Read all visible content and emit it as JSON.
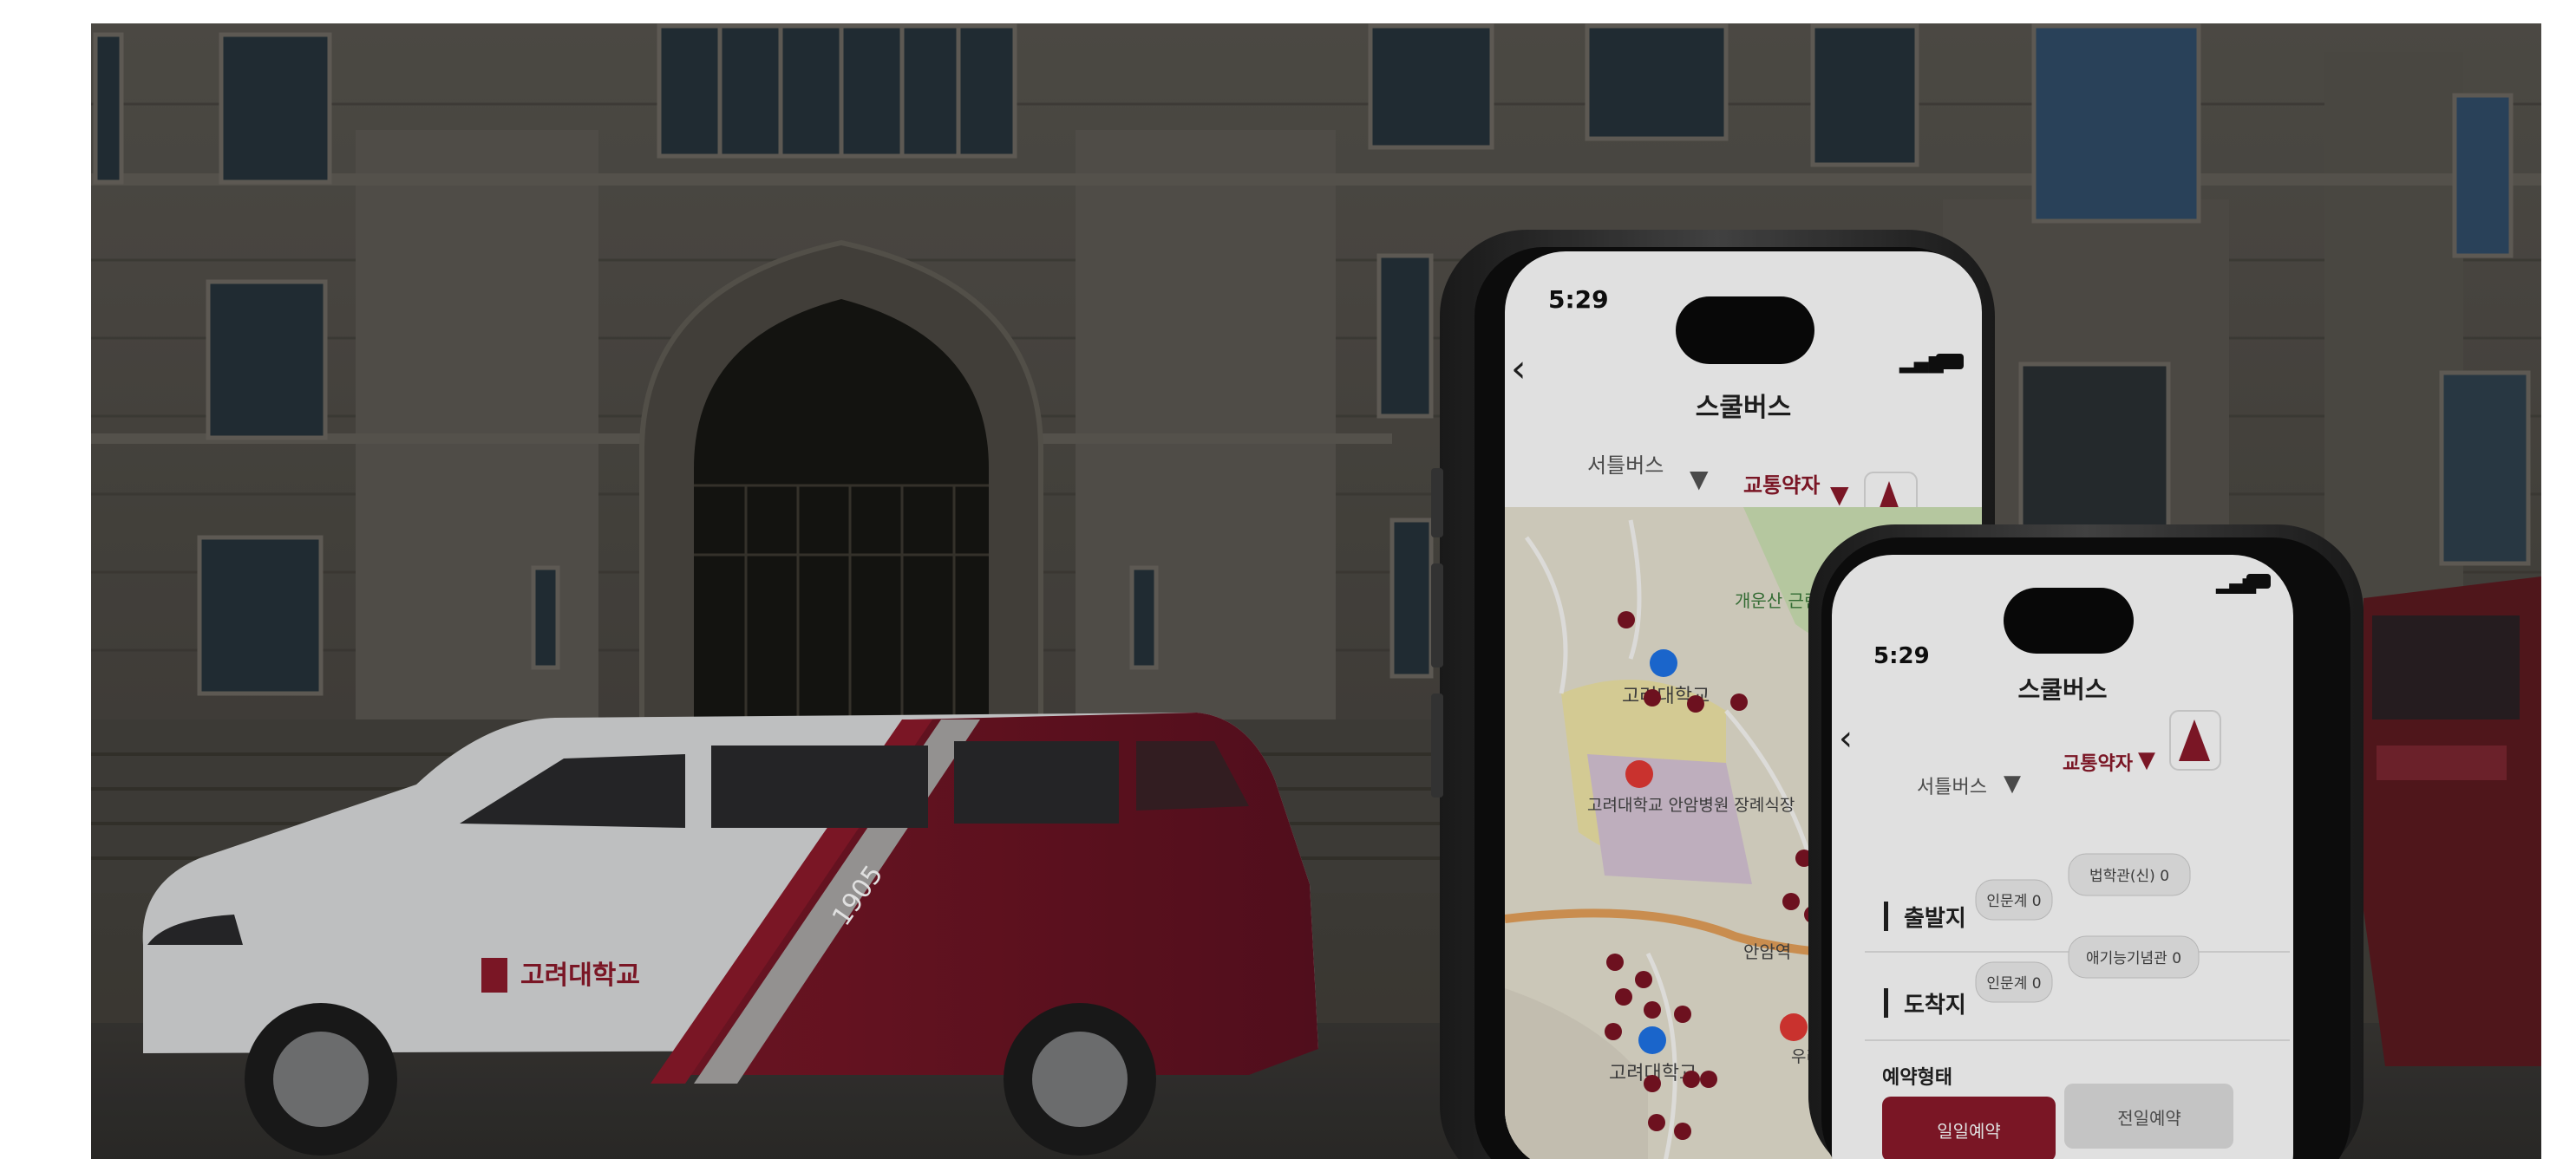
{
  "phone_back": {
    "status_time": "5:29",
    "screen_title": "스쿨버스",
    "filter_left": "서틀버스",
    "filter_right": "교통약자",
    "map_labels": [
      "개운산 근린공원",
      "고려대학교",
      "고려대학교 안암병원 장례식장",
      "안암역",
      "우리은행",
      "고려대학교"
    ]
  },
  "phone_front": {
    "status_time": "5:29",
    "screen_title": "스쿨버스",
    "filter_left": "서틀버스",
    "filter_right": "교통약자",
    "departure_label": "출발지",
    "departure_chips": [
      "인문계 0",
      "법학관(신) 0"
    ],
    "arrival_label": "도착지",
    "arrival_chips": [
      "인문계 0",
      "애기능기념관 0"
    ],
    "reservation_label": "예약형태",
    "reservation_buttons": [
      "일일예약",
      "전일예약"
    ]
  },
  "van": {
    "decal_text": "고려대학교",
    "stripe_text": "1905"
  },
  "colors": {
    "brand_red": "#8b1a2b",
    "stone": "#4d4a44",
    "phone_frame": "#2b2b2b"
  }
}
